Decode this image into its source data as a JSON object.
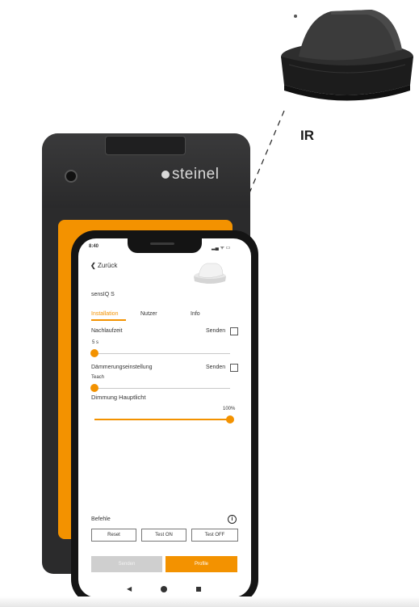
{
  "sensor": {
    "label": "IR"
  },
  "remote": {
    "brand": "steinel"
  },
  "phone": {
    "status_time": "8:40",
    "back_label": "Zurück",
    "device_name": "sensIQ S",
    "tabs": [
      {
        "label": "Installation",
        "active": true
      },
      {
        "label": "Nutzer",
        "active": false
      },
      {
        "label": "Info",
        "active": false
      }
    ],
    "settings": {
      "nachlaufzeit": {
        "label": "Nachlaufzeit",
        "send_label": "Senden",
        "value": "5 s",
        "level": 0.0
      },
      "daemmerung": {
        "label": "Dämmerungseinstellung",
        "send_label": "Senden",
        "value": "Teach",
        "level": 0.0
      },
      "dimmung": {
        "label": "Dimmung Hauptlicht",
        "value": "100%",
        "level": 1.0
      }
    },
    "commands": {
      "title": "Befehle",
      "buttons": [
        "Reset",
        "Test ON",
        "Test OFF"
      ]
    },
    "actions": {
      "send": "Senden",
      "profile": "Profile"
    }
  },
  "colors": {
    "accent": "#f39200",
    "device_dark": "#2b2b2c"
  }
}
